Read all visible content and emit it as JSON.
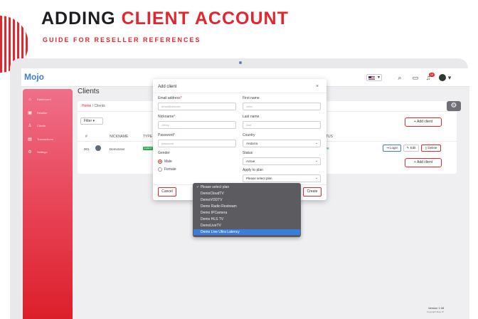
{
  "banner": {
    "title_part1": "ADDING",
    "title_part2": "CLIENT ACCOUNT",
    "subtitle": "GUIDE FOR RESELLER REFERENCES",
    "accent_color": "#e3262e"
  },
  "app": {
    "logo": "Mojo",
    "notification_count": "10"
  },
  "sidebar": {
    "items": [
      {
        "label": "Dashboard",
        "icon": "home-icon"
      },
      {
        "label": "Reseller",
        "icon": "users-icon"
      },
      {
        "label": "Clients",
        "icon": "user-icon"
      },
      {
        "label": "Transactions",
        "icon": "receipt-icon"
      },
      {
        "label": "Settings",
        "icon": "gear-icon"
      }
    ]
  },
  "page": {
    "title": "Clients",
    "breadcrumb_home": "Home",
    "breadcrumb_current": "Clients",
    "filter_label": "Filter",
    "add_client_label": "+ Add client",
    "table": {
      "headers": [
        "#",
        "NICKNAME",
        "TYPE",
        "STATUS"
      ],
      "row": {
        "id": "001",
        "nickname": "DemoUser",
        "type": "CLIENT",
        "status": "Active"
      }
    },
    "actions": {
      "login": "Login",
      "edit": "Edit",
      "delete": "Delete"
    },
    "version": "Version 1.08",
    "copyright": "Copyright Mojo IP"
  },
  "modal": {
    "title": "Add client",
    "close_symbol": "×",
    "email_label": "Email address",
    "email_placeholder": "email@domain",
    "firstname_label": "First name",
    "firstname_placeholder": "John",
    "nickname_label": "Nickname",
    "nickname_placeholder": "Johny",
    "lastname_label": "Last name",
    "lastname_placeholder": "Doe",
    "password_label": "Password",
    "password_placeholder": "password",
    "country_label": "Country",
    "country_value": "Andorra",
    "gender_label": "Gender",
    "gender_male": "Male",
    "gender_female": "Female",
    "status_label": "Status",
    "status_value": "Active",
    "plan_label": "Apply to plan",
    "plan_value": "Please select plan",
    "cancel_label": "Cancel",
    "create_label": "Create"
  },
  "plan_dropdown": {
    "options": [
      "Please select plan",
      "DemoCloudTV",
      "DemoVODTV",
      "Demo Radio Restream",
      "Demo IPCamera",
      "Demo HLS TV",
      "DemoLiveTV",
      "Demo Live Ultra Latency"
    ],
    "checked_index": 0,
    "highlighted_index": 7
  }
}
